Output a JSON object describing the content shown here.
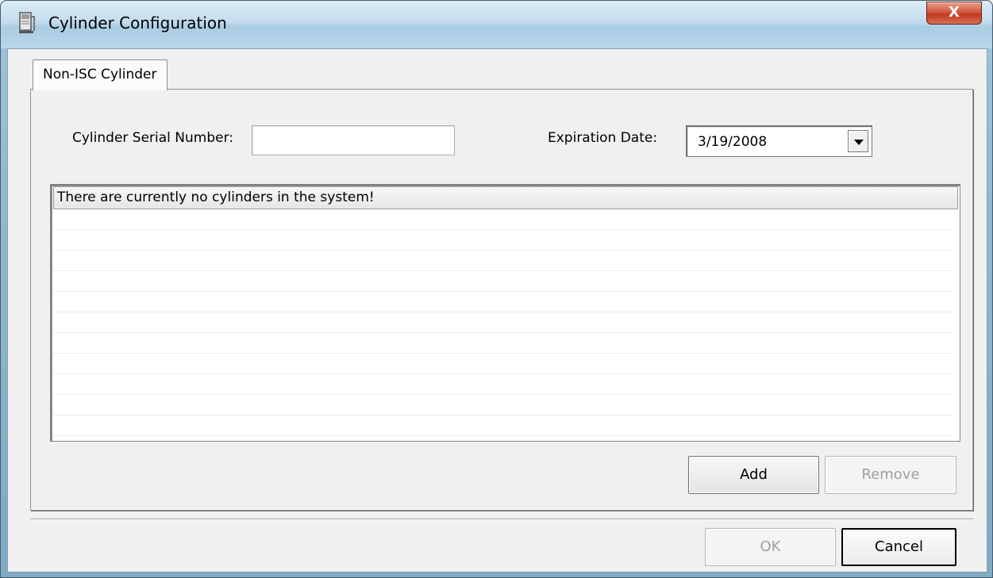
{
  "window": {
    "title": "Cylinder Configuration",
    "close_label": "X"
  },
  "tabs": [
    {
      "label": "Non-ISC Cylinder",
      "selected": true
    }
  ],
  "form": {
    "serial_label": "Cylinder Serial Number:",
    "serial_value": "",
    "expiration_label": "Expiration Date:",
    "expiration_value": "3/19/2008"
  },
  "list": {
    "header": "There are currently no cylinders in the system!",
    "rows": []
  },
  "buttons": {
    "add": "Add",
    "remove": "Remove",
    "ok": "OK",
    "cancel": "Cancel"
  },
  "colors": {
    "title_bar": "#c3dced",
    "close_button": "#c1391e",
    "window_bg": "#f0f0f0"
  }
}
